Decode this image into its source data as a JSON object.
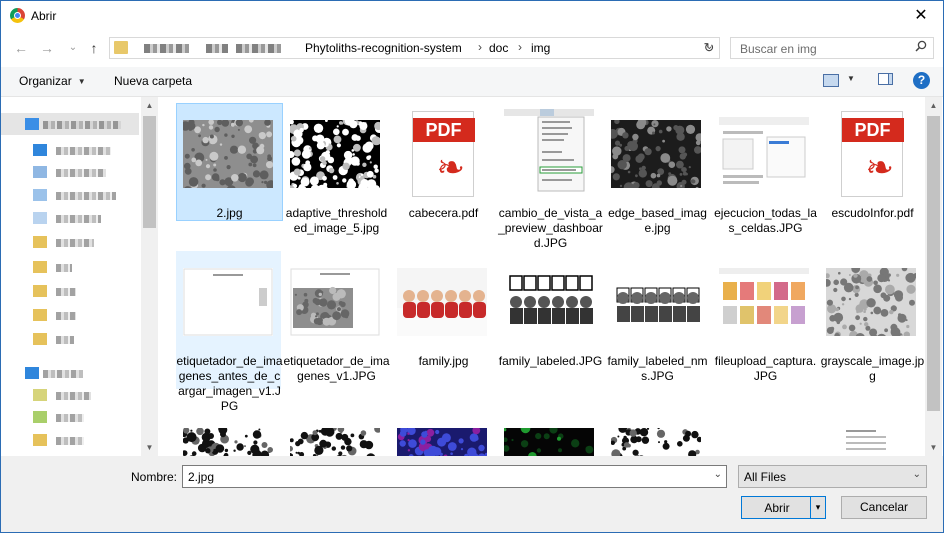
{
  "window": {
    "title": "Abrir",
    "close_glyph": "✕"
  },
  "nav_buttons": {
    "back": "←",
    "forward": "→",
    "recent": "⌄",
    "up": "↑"
  },
  "address": {
    "crumbs": [
      "Phytoliths-recognition-system",
      "doc",
      "img"
    ],
    "separator": "›",
    "dropdown": "⌄",
    "refresh": "↻"
  },
  "search": {
    "placeholder": "Buscar en img",
    "icon": "magnifier-icon"
  },
  "commandbar": {
    "organize": "Organizar",
    "new_folder": "Nueva carpeta",
    "view_arrow": "▼",
    "help": "?"
  },
  "files": [
    {
      "name": "2.jpg",
      "kind": "photo-gray",
      "selected": true
    },
    {
      "name": "adaptive_thresholded_image_5.jpg",
      "kind": "bw-noise"
    },
    {
      "name": "cabecera.pdf",
      "kind": "pdf"
    },
    {
      "name": "cambio_de_vista_a_preview_dashboard.JPG",
      "kind": "menu-screenshot"
    },
    {
      "name": "edge_based_image.jpg",
      "kind": "dark-noise"
    },
    {
      "name": "ejecucion_todas_las_celdas.JPG",
      "kind": "screenshot"
    },
    {
      "name": "escudoInfor.pdf",
      "kind": "pdf"
    },
    {
      "name": "etiquetador_de_imagenes_antes_de_cargar_imagen_v1.JPG",
      "kind": "blank-doc",
      "hover": true
    },
    {
      "name": "etiquetador_de_imagenes_v1.JPG",
      "kind": "doc-with-photo"
    },
    {
      "name": "family.jpg",
      "kind": "family"
    },
    {
      "name": "family_labeled.JPG",
      "kind": "family-bw"
    },
    {
      "name": "family_labeled_nms.JPG",
      "kind": "family-bw2"
    },
    {
      "name": "fileupload_captura.JPG",
      "kind": "gallery"
    },
    {
      "name": "grayscale_image.jpg",
      "kind": "gray-noise"
    },
    {
      "name": "",
      "kind": "bw-noise-light"
    },
    {
      "name": "",
      "kind": "bw-noise-light"
    },
    {
      "name": "",
      "kind": "blue-noise"
    },
    {
      "name": "",
      "kind": "black-green"
    },
    {
      "name": "",
      "kind": "bw-noise-light"
    },
    {
      "name": "",
      "kind": "screenshot-small"
    },
    {
      "name": "",
      "kind": "doc-photo-small"
    }
  ],
  "footer": {
    "name_label": "Nombre:",
    "name_value": "2.jpg",
    "filetype": "All Files",
    "open": "Abrir",
    "cancel": "Cancelar",
    "dropdown": "⌄",
    "split_arrow": "▾"
  },
  "scroll_glyphs": {
    "up": "▲",
    "down": "▼"
  }
}
